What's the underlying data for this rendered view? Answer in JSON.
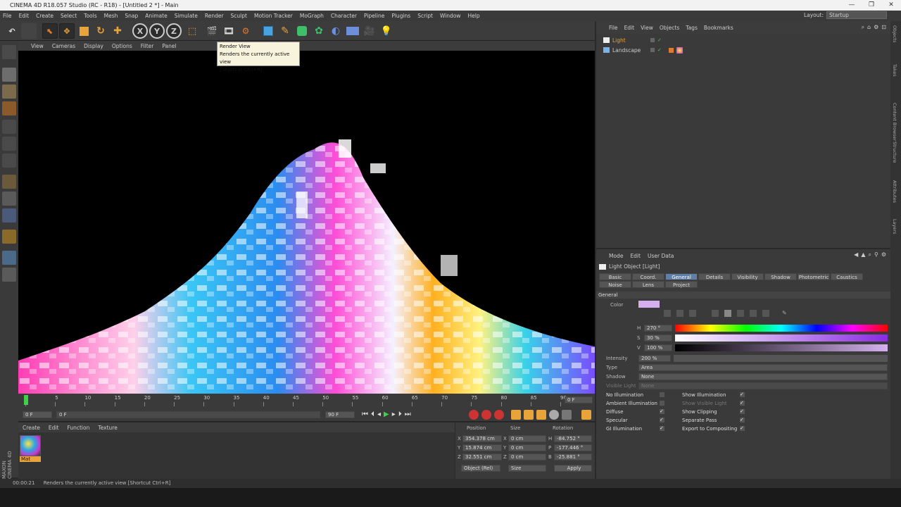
{
  "window": {
    "title": "CINEMA 4D R18.057 Studio (RC - R18) - [Untitled 2 *] - Main"
  },
  "menubar": [
    "File",
    "Edit",
    "Create",
    "Select",
    "Tools",
    "Mesh",
    "Snap",
    "Animate",
    "Simulate",
    "Render",
    "Sculpt",
    "Motion Tracker",
    "MoGraph",
    "Character",
    "Pipeline",
    "Plugins",
    "Script",
    "Window",
    "Help"
  ],
  "layout": {
    "label": "Layout:",
    "value": "Startup"
  },
  "tooltip": {
    "title": "Render View",
    "desc": "Renders the currently active view",
    "shortcut": "[Shortcut Ctrl+R]"
  },
  "toolbar": {
    "x": "X",
    "y": "Y",
    "z": "Z"
  },
  "viewport_menu": [
    "View",
    "Cameras",
    "Display",
    "Options",
    "Filter",
    "Panel"
  ],
  "timeline": {
    "ticks": [
      "0",
      "5",
      "10",
      "15",
      "20",
      "25",
      "30",
      "35",
      "40",
      "45",
      "50",
      "55",
      "60",
      "65",
      "70",
      "75",
      "80",
      "85",
      "90"
    ],
    "current_frame": "0 F",
    "start": "0 F",
    "start2": "0 F",
    "end": "90 F",
    "end2": "90 F"
  },
  "material_menu": [
    "Create",
    "Edit",
    "Function",
    "Texture"
  ],
  "material": {
    "name": "Mat"
  },
  "coords": {
    "headers": [
      "Position",
      "Size",
      "Rotation"
    ],
    "rows": [
      {
        "axis": "X",
        "pos": "354.378 cm",
        "size": "0 cm",
        "rot_label": "H",
        "rot": "-84.752 °"
      },
      {
        "axis": "Y",
        "pos": "15.874 cm",
        "size": "0 cm",
        "rot_label": "P",
        "rot": "-177.446 °"
      },
      {
        "axis": "Z",
        "pos": "32.551 cm",
        "size": "0 cm",
        "rot_label": "B",
        "rot": "-25.881 °"
      }
    ],
    "mode": "Object (Rel)",
    "size_mode": "Size",
    "apply": "Apply"
  },
  "status": {
    "time": "00:00:21",
    "text": "Renders the currently active view [Shortcut Ctrl+R]"
  },
  "objects_menu": [
    "File",
    "Edit",
    "View",
    "Objects",
    "Tags",
    "Bookmarks"
  ],
  "objects": [
    {
      "name": "Light"
    },
    {
      "name": "Landscape"
    }
  ],
  "attr_menu": [
    "Mode",
    "Edit",
    "User Data"
  ],
  "attr": {
    "object_title": "Light Object [Light]",
    "tabs_row1": [
      "Basic",
      "Coord.",
      "General",
      "Details",
      "Visibility",
      "Shadow",
      "Photometric",
      "Caustics"
    ],
    "tabs_row2": [
      "Noise",
      "Lens",
      "Project"
    ],
    "section": "General",
    "color_label": "Color",
    "h_label": "H",
    "h_value": "270 °",
    "s_label": "S",
    "s_value": "30 %",
    "v_label": "V",
    "v_value": "100 %",
    "intensity_label": "Intensity",
    "intensity_value": "200 %",
    "type_label": "Type",
    "type_value": "Area",
    "shadow_label": "Shadow",
    "shadow_value": "None",
    "visible_light_label": "Visible Light",
    "visible_light_value": "None",
    "checks_left": [
      "No Illumination",
      "Ambient Illumination",
      "Diffuse",
      "Specular",
      "GI Illumination"
    ],
    "checks_right": [
      "Show Illumination",
      "Show Visible Light",
      "Show Clipping",
      "Separate Pass",
      "Export to Compositing"
    ],
    "accent": "#5f7fa8",
    "color_swatch": "#d4b0ee"
  },
  "right_tabs": [
    "Objects",
    "Takes",
    "Content Browser",
    "Structure",
    "Attributes",
    "Layers"
  ],
  "brand": {
    "maxon": "MAXON",
    "c4d": "CINEMA 4D"
  }
}
